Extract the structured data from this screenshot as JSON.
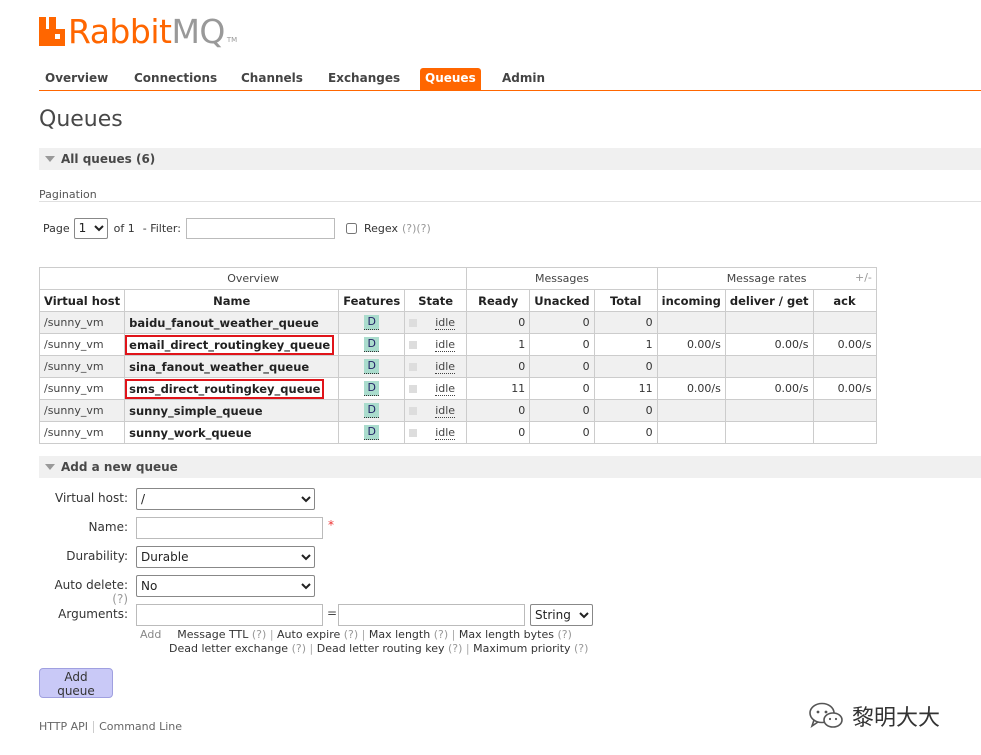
{
  "brand": {
    "name_part1": "Rabbit",
    "name_part2": "MQ",
    "tm": "TM"
  },
  "nav": {
    "tabs": [
      {
        "label": "Overview"
      },
      {
        "label": "Connections"
      },
      {
        "label": "Channels"
      },
      {
        "label": "Exchanges"
      },
      {
        "label": "Queues",
        "active": true
      },
      {
        "label": "Admin"
      }
    ]
  },
  "page_title": "Queues",
  "all_queues_header": "All queues (6)",
  "pagination": {
    "label": "Pagination",
    "page_label": "Page",
    "page_value": "1",
    "of_label": "of 1",
    "filter_label": "- Filter:",
    "filter_value": "",
    "regex_label": "Regex",
    "regex_help": "(?)(?)"
  },
  "table": {
    "group_headers": {
      "overview": "Overview",
      "messages": "Messages",
      "rates": "Message rates"
    },
    "columns": [
      "Virtual host",
      "Name",
      "Features",
      "State",
      "Ready",
      "Unacked",
      "Total",
      "incoming",
      "deliver / get",
      "ack"
    ],
    "plus_minus": "+/-",
    "rows": [
      {
        "vhost": "/sunny_vm",
        "name": "baidu_fanout_weather_queue",
        "feature": "D",
        "state": "idle",
        "ready": "0",
        "unacked": "0",
        "total": "0",
        "incoming": "",
        "deliver": "",
        "ack": "",
        "highlight": false
      },
      {
        "vhost": "/sunny_vm",
        "name": "email_direct_routingkey_queue",
        "feature": "D",
        "state": "idle",
        "ready": "1",
        "unacked": "0",
        "total": "1",
        "incoming": "0.00/s",
        "deliver": "0.00/s",
        "ack": "0.00/s",
        "highlight": true
      },
      {
        "vhost": "/sunny_vm",
        "name": "sina_fanout_weather_queue",
        "feature": "D",
        "state": "idle",
        "ready": "0",
        "unacked": "0",
        "total": "0",
        "incoming": "",
        "deliver": "",
        "ack": "",
        "highlight": false
      },
      {
        "vhost": "/sunny_vm",
        "name": "sms_direct_routingkey_queue",
        "feature": "D",
        "state": "idle",
        "ready": "11",
        "unacked": "0",
        "total": "11",
        "incoming": "0.00/s",
        "deliver": "0.00/s",
        "ack": "0.00/s",
        "highlight": true
      },
      {
        "vhost": "/sunny_vm",
        "name": "sunny_simple_queue",
        "feature": "D",
        "state": "idle",
        "ready": "0",
        "unacked": "0",
        "total": "0",
        "incoming": "",
        "deliver": "",
        "ack": "",
        "highlight": false
      },
      {
        "vhost": "/sunny_vm",
        "name": "sunny_work_queue",
        "feature": "D",
        "state": "idle",
        "ready": "0",
        "unacked": "0",
        "total": "0",
        "incoming": "",
        "deliver": "",
        "ack": "",
        "highlight": false
      }
    ]
  },
  "add_queue": {
    "header": "Add a new queue",
    "vhost_label": "Virtual host:",
    "vhost_value": "/",
    "name_label": "Name:",
    "name_value": "",
    "required_mark": "*",
    "durability_label": "Durability:",
    "durability_value": "Durable",
    "auto_delete_label": "Auto delete:",
    "auto_delete_help": "(?)",
    "auto_delete_value": "No",
    "arguments_label": "Arguments:",
    "arg_key_value": "",
    "equals": "=",
    "arg_value_value": "",
    "arg_type_value": "String",
    "add_word": "Add",
    "links_line1": [
      {
        "label": "Message TTL",
        "help": "(?)"
      },
      {
        "label": "Auto expire",
        "help": "(?)"
      },
      {
        "label": "Max length",
        "help": "(?)"
      },
      {
        "label": "Max length bytes",
        "help": "(?)"
      }
    ],
    "links_line2": [
      {
        "label": "Dead letter exchange",
        "help": "(?)"
      },
      {
        "label": "Dead letter routing key",
        "help": "(?)"
      },
      {
        "label": "Maximum priority",
        "help": "(?)"
      }
    ],
    "submit_label": "Add queue"
  },
  "footer": {
    "http_api": "HTTP API",
    "command_line": "Command Line"
  },
  "watermark": {
    "text": "黎明大大",
    "icon": "wechat-icon"
  },
  "colors": {
    "accent": "#ff6600",
    "highlight_outline": "#e0141a",
    "badge": "#aadccd",
    "button": "#c9c9f7"
  }
}
